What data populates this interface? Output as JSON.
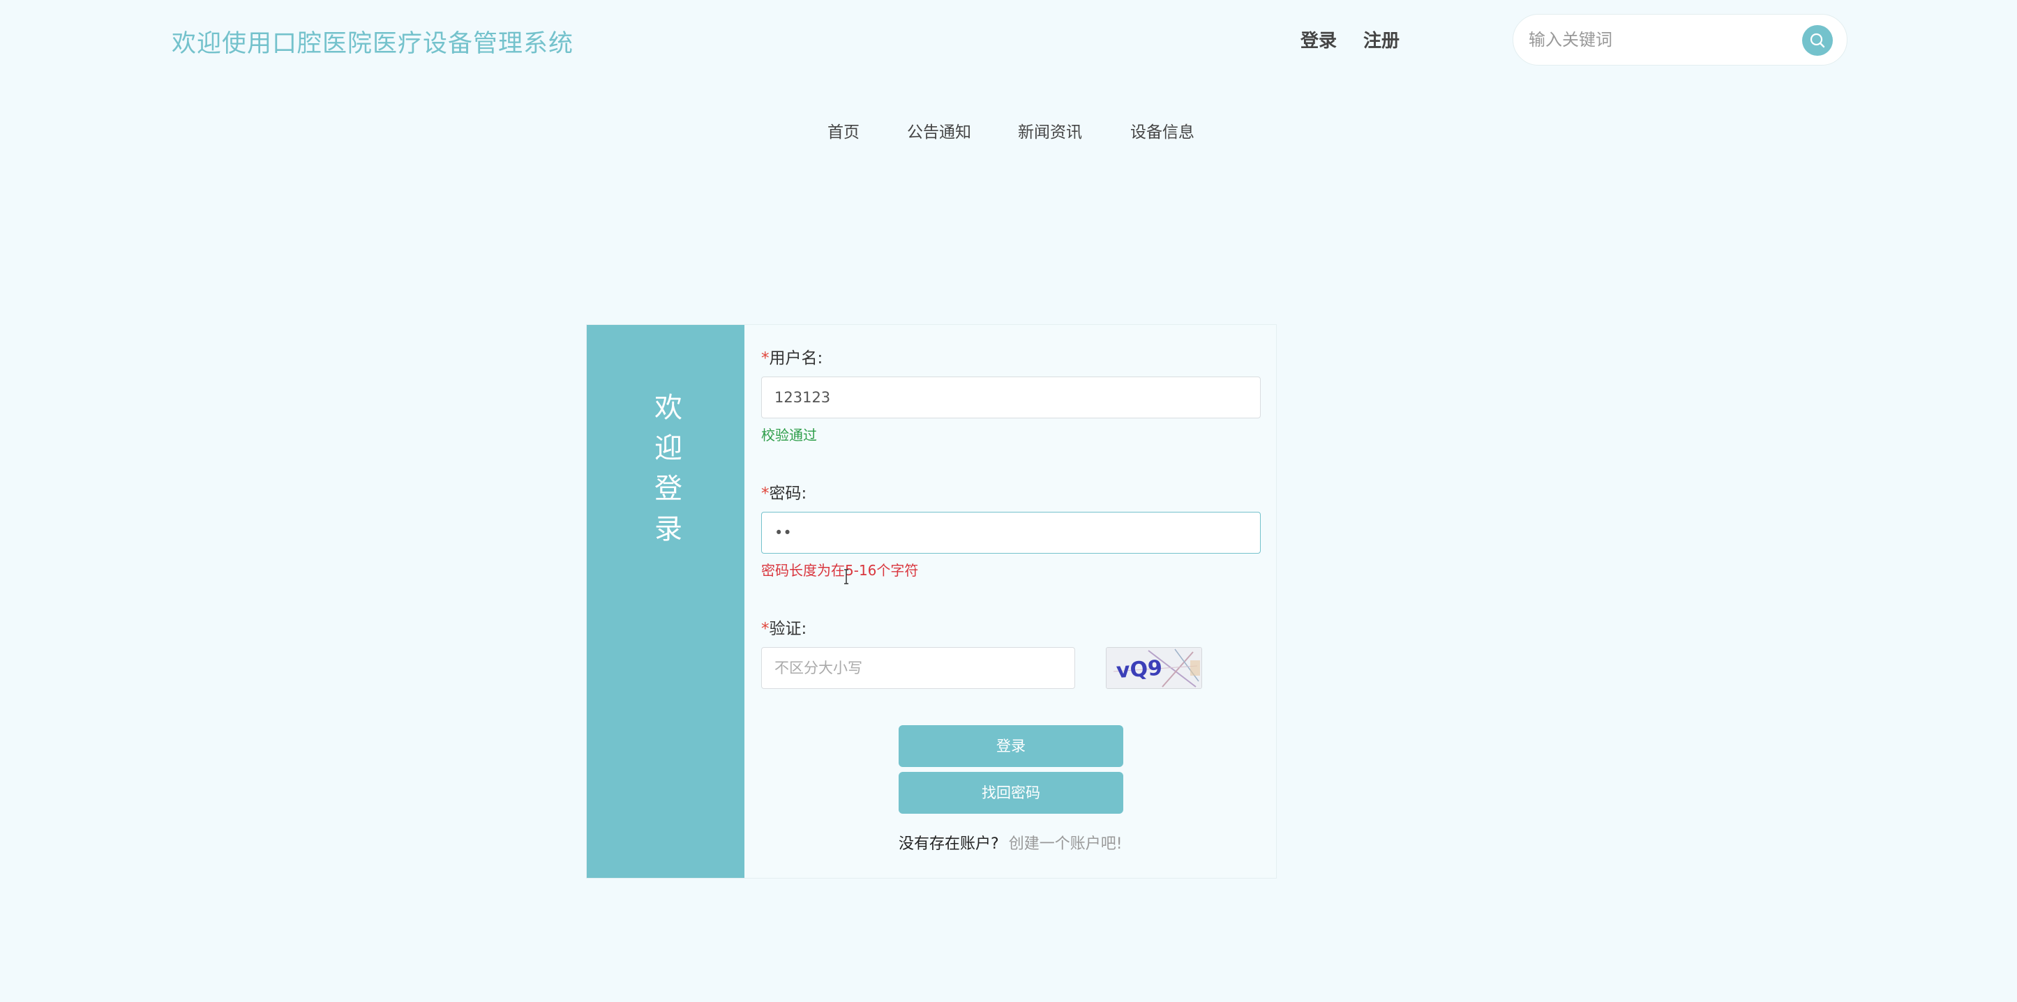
{
  "header": {
    "site_title": "欢迎使用口腔医院医疗设备管理系统",
    "login_label": "登录",
    "register_label": "注册",
    "search_placeholder": "输入关键词",
    "search_icon": "search-icon"
  },
  "nav": {
    "items": [
      {
        "label": "首页"
      },
      {
        "label": "公告通知"
      },
      {
        "label": "新闻资讯"
      },
      {
        "label": "设备信息"
      }
    ]
  },
  "login": {
    "welcome_text": "欢迎登录",
    "username": {
      "required_mark": "*",
      "label": "用户名:",
      "value": "123123",
      "hint": "校验通过"
    },
    "password": {
      "required_mark": "*",
      "label": "密码:",
      "value": "••",
      "hint": "密码长度为在5-16个字符"
    },
    "captcha": {
      "required_mark": "*",
      "label": "验证:",
      "placeholder": "不区分大小写",
      "image_text": "vQ9"
    },
    "login_button": "登录",
    "forgot_button": "找回密码",
    "no_account_text": "没有存在账户?",
    "create_account_link": "创建一个账户吧!"
  },
  "colors": {
    "accent": "#74c2cc",
    "background": "#f2fafd",
    "success": "#2e9e4a",
    "error": "#d9363e",
    "required": "#e0463b"
  }
}
